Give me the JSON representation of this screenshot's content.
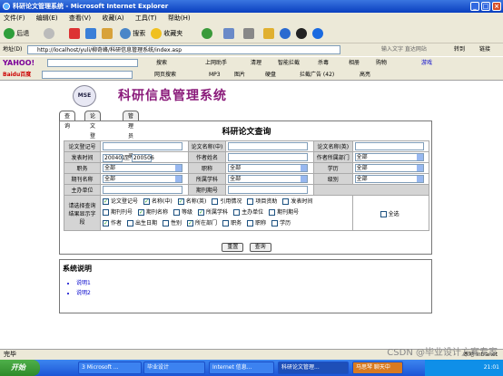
{
  "window": {
    "title": "科研论文管理系统 - Microsoft Internet Explorer"
  },
  "menu": [
    "文件(F)",
    "编辑(E)",
    "查看(V)",
    "收藏(A)",
    "工具(T)",
    "帮助(H)"
  ],
  "toolbar": {
    "back": "后退",
    "search": "搜索",
    "favorites": "收藏夹"
  },
  "address": {
    "label": "地址(D)",
    "url": "http://localhost/yuli/柳奇峰/科研信息管理系统/index.asp",
    "go": "转到",
    "links": "链接",
    "input_hint": "输入文字 直达网站"
  },
  "yahoo_bar": {
    "brand": "YAHOO!",
    "search": "搜索",
    "items": [
      "上网助手",
      "清理",
      "智能拦截",
      "杀毒",
      "相册",
      "购物",
      "游戏"
    ]
  },
  "baidu_bar": {
    "brand": "Baidu百度",
    "search": "网页搜索",
    "items": [
      "MP3",
      "图片",
      "硬盘",
      "拦截广告 (42)",
      "高亮"
    ]
  },
  "page": {
    "logo": "MSE",
    "site_title": "科研信息管理系统",
    "tabs": [
      "查询",
      "论文登记",
      "管理员登录"
    ],
    "query_title": "科研论文查询",
    "fields": {
      "paper_no": "论文登记号",
      "paper_name_cn": "论文名称(中)",
      "paper_name_en": "论文名称(英)",
      "pub_time": "发表时间",
      "time_from": "200401",
      "to": "至",
      "time_to": "200506",
      "author_name": "作者姓名",
      "author_dept": "作者所属部门",
      "title_label": "职务",
      "rank_label": "职称",
      "degree_label": "学历",
      "journal_name": "期刊名称",
      "subject": "所属学科",
      "level": "级别",
      "host_unit": "主办单位",
      "issue_no": "期刊期号",
      "all": "全部",
      "display_label": "请选择查询结果显示字段"
    },
    "checkboxes": [
      {
        "label": "论文登记号",
        "checked": true
      },
      {
        "label": "名称(中)",
        "checked": true
      },
      {
        "label": "名称(英)",
        "checked": true
      },
      {
        "label": "引用情况",
        "checked": false
      },
      {
        "label": "项目资助",
        "checked": false
      },
      {
        "label": "发表时间",
        "checked": false
      },
      {
        "label": "期刊刊号",
        "checked": false
      },
      {
        "label": "期刊名称",
        "checked": true
      },
      {
        "label": "等级",
        "checked": false
      },
      {
        "label": "所属学科",
        "checked": true
      },
      {
        "label": "主办单位",
        "checked": false
      },
      {
        "label": "期刊期号",
        "checked": false
      },
      {
        "label": "作者",
        "checked": true
      },
      {
        "label": "出生日期",
        "checked": false
      },
      {
        "label": "性别",
        "checked": false
      },
      {
        "label": "所在部门",
        "checked": true
      },
      {
        "label": "职务",
        "checked": false
      },
      {
        "label": "职称",
        "checked": false
      },
      {
        "label": "学历",
        "checked": false
      }
    ],
    "select_all": "全选",
    "reset": "重置",
    "query": "查询",
    "sys_title": "系统说明",
    "sys_links": [
      "说明1",
      "说明2"
    ]
  },
  "status": {
    "text": "完毕",
    "zone": "本地 Intranet"
  },
  "taskbar": {
    "start": "开始",
    "tasks": [
      "3 Microsoft ...",
      "毕业设计",
      "Internet 信息...",
      "科研论文管理...",
      "马思琴 聊天中"
    ],
    "clock": "21:01"
  },
  "watermark": "CSDN @毕业设计方案专家"
}
